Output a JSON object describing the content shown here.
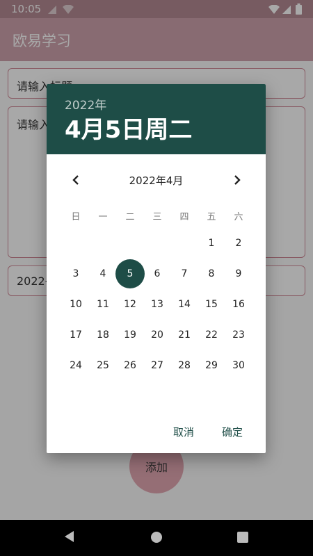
{
  "status_bar": {
    "time": "10:05"
  },
  "app": {
    "title": "欧易学习",
    "title_field_placeholder": "请输入标题:",
    "content_field_placeholder": "请输入",
    "date_field_value": "2022-8",
    "add_button_label": "添加"
  },
  "date_picker": {
    "header_year": "2022年",
    "header_date": "4月5日周二",
    "month_label": "2022年4月",
    "weekdays": [
      "日",
      "一",
      "二",
      "三",
      "四",
      "五",
      "六"
    ],
    "first_weekday_index": 5,
    "days": [
      "1",
      "2",
      "3",
      "4",
      "5",
      "6",
      "7",
      "8",
      "9",
      "10",
      "11",
      "12",
      "13",
      "14",
      "15",
      "16",
      "17",
      "18",
      "19",
      "20",
      "21",
      "22",
      "23",
      "24",
      "25",
      "26",
      "27",
      "28",
      "29",
      "30"
    ],
    "selected_day": "5",
    "cancel_label": "取消",
    "ok_label": "确定",
    "accent_color": "#1e4d47"
  },
  "icons": {
    "status": [
      "wifi-icon",
      "signal-icon",
      "battery-icon"
    ],
    "navigation": [
      "back-icon",
      "home-icon",
      "recents-icon"
    ],
    "picker": [
      "chevron-left-icon",
      "chevron-right-icon"
    ]
  }
}
